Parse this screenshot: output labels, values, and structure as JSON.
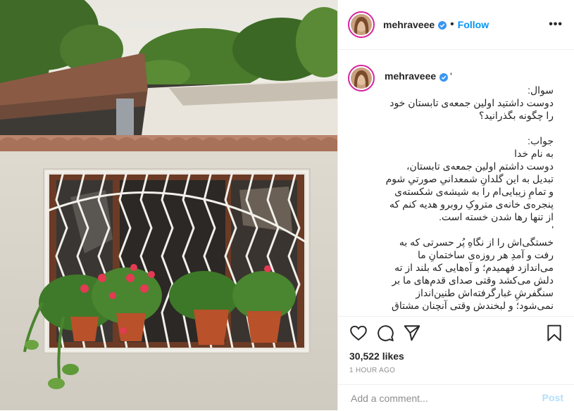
{
  "post": {
    "username": "mehraveee",
    "separator": "•",
    "follow_label": "Follow",
    "more_label": "•••"
  },
  "caption": {
    "username": "mehraveee",
    "quote_mark": "'",
    "text": "سوال:\nدوست داشتید اولین جمعه‌ی تابستان خود را چگونه بگذرانید؟\n\nجواب:\nبه نام خدا\nدوست داشتم اولین جمعه‌ی تابستان، تبدیل به این گلدانِ شمعدانیِ صورتیِ شوم و تمامِ زیبایی‌ام را به شیشه‌ی شکسته‌ی پنجره‌ی خانه‌ی متروکِ روبرو هدیه کنم که از تنها رها شدن خسته است.\n'\nخستگی‌اش را از نگاهِ پُر حسرتی که به رفت و آمدِ هر روزه‌ی ساختمانِ ما می‌اندازد فهمیدم؛ و آه‌هایی که بلند از ته دلش می‌کشد وقتی صدای قدم‌های ما بر سنگفرشِ غبارگرفته‌اش طنین‌انداز نمی‌شود؛ و لبخندش وقتی آنچنان مشتاق"
  },
  "stats": {
    "likes": "30,522 likes",
    "time": "1 HOUR AGO"
  },
  "comment": {
    "placeholder": "Add a comment...",
    "post_label": "Post"
  },
  "icons": [
    "verified-badge-icon",
    "heart-icon",
    "comment-icon",
    "share-icon",
    "bookmark-icon"
  ],
  "colors": {
    "accent": "#0095f6",
    "post_disabled": "#b2dffc",
    "story_ring": "#d6249f"
  }
}
